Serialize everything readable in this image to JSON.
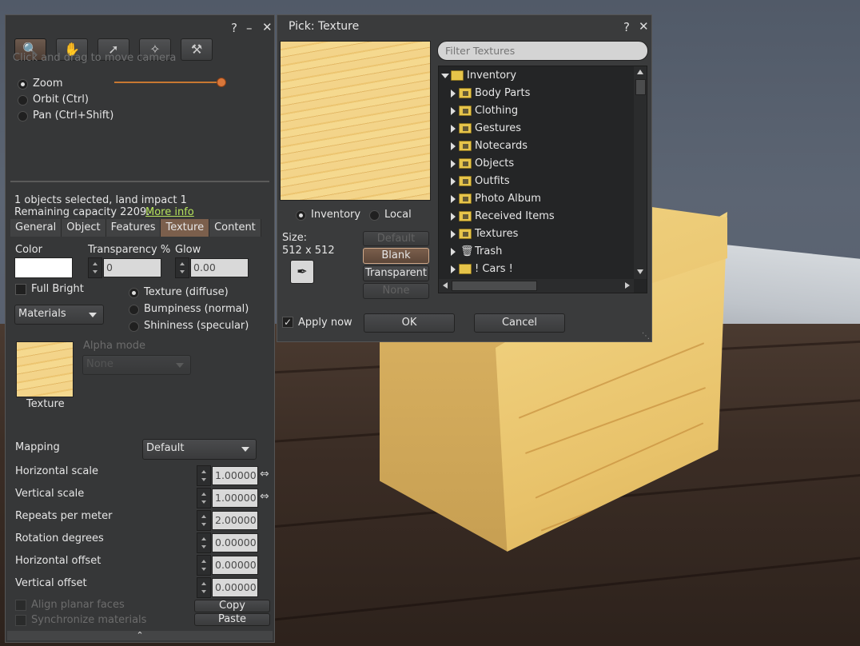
{
  "build_panel": {
    "hint": "Click and drag to move camera",
    "camera_modes": [
      {
        "label": "Zoom",
        "selected": true
      },
      {
        "label": "Orbit (Ctrl)",
        "selected": false
      },
      {
        "label": "Pan (Ctrl+Shift)",
        "selected": false
      }
    ],
    "zoom_level": 1.0,
    "selection_info": "1 objects selected, land impact 1",
    "capacity_text": "Remaining capacity 2209.",
    "more_info_link": "More info",
    "tabs": [
      "General",
      "Object",
      "Features",
      "Texture",
      "Content"
    ],
    "active_tab": "Texture",
    "color_label": "Color",
    "transparency_label": "Transparency %",
    "transparency_value": "0",
    "glow_label": "Glow",
    "glow_value": "0.00",
    "full_bright_label": "Full Bright",
    "materials_value": "Materials",
    "texture_types": [
      {
        "label": "Texture (diffuse)",
        "selected": true
      },
      {
        "label": "Bumpiness (normal)",
        "selected": false
      },
      {
        "label": "Shininess (specular)",
        "selected": false
      }
    ],
    "texture_swatch_label": "Texture",
    "alpha_mode_label": "Alpha mode",
    "alpha_mode_value": "None",
    "mapping_label": "Mapping",
    "mapping_value": "Default",
    "params": [
      {
        "label": "Horizontal scale",
        "value": "1.00000"
      },
      {
        "label": "Vertical scale",
        "value": "1.00000"
      },
      {
        "label": "Repeats per meter",
        "value": "2.00000"
      },
      {
        "label": "Rotation degrees",
        "value": "0.00000"
      },
      {
        "label": "Horizontal offset",
        "value": "0.00000"
      },
      {
        "label": "Vertical offset",
        "value": "0.00000"
      }
    ],
    "align_planar_label": "Align planar faces",
    "sync_materials_label": "Synchronize materials",
    "copy_label": "Copy",
    "paste_label": "Paste",
    "help_glyph": "?",
    "minimize_glyph": "–",
    "close_glyph": "✕"
  },
  "picker": {
    "title": "Pick: Texture",
    "filter_placeholder": "Filter Textures",
    "source_options": [
      {
        "label": "Inventory",
        "selected": true
      },
      {
        "label": "Local",
        "selected": false
      }
    ],
    "size_label": "Size:",
    "size_value": "512 x 512",
    "default_label": "Default",
    "blank_label": "Blank",
    "transparent_label": "Transparent",
    "none_label": "None",
    "apply_now_label": "Apply now",
    "ok_label": "OK",
    "cancel_label": "Cancel",
    "inventory_root": "Inventory",
    "inventory_items": [
      "Body Parts",
      "Clothing",
      "Gestures",
      "Notecards",
      "Objects",
      "Outfits",
      "Photo Album",
      "Received Items",
      "Textures",
      "Trash",
      "! Cars !"
    ],
    "help_glyph": "?",
    "close_glyph": "✕"
  },
  "colors": {
    "panel_bg": "#363738",
    "active_tab": "#7b5f4c",
    "link": "#b6e35c",
    "slider_track": "#c87832",
    "folder": "#e6c44a"
  }
}
